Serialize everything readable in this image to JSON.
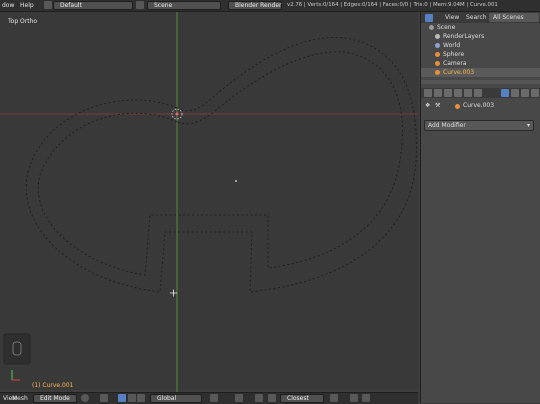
{
  "topbar": {
    "menu_window": "dow",
    "menu_help": "Help",
    "screen_layout": "Default",
    "scene": "Scene",
    "render_engine": "Blender Render",
    "stats": "v2.76 | Verts:0/164 | Edges:0/164 | Faces:0/0 | Tris:0 | Mem:9.04M | Curve.001"
  },
  "viewport": {
    "view_label": "Top Ortho",
    "object_label": "(1) Curve.001"
  },
  "outliner": {
    "tabs": [
      "View",
      "Search",
      "All Scenes"
    ],
    "items": [
      "Scene",
      "RenderLayers",
      "World",
      "Sphere",
      "Camera",
      "Curve.003"
    ]
  },
  "properties": {
    "object_name": "Curve.003",
    "add_modifier": "Add Modifier"
  },
  "bottombar": {
    "view_menu": "View",
    "mesh_menu": "Mesh",
    "mode": "Edit Mode",
    "pivot": "Global",
    "snap": "Closest"
  },
  "colors": {
    "accent": "#5680c2",
    "selected_text": "#ffb84c"
  }
}
